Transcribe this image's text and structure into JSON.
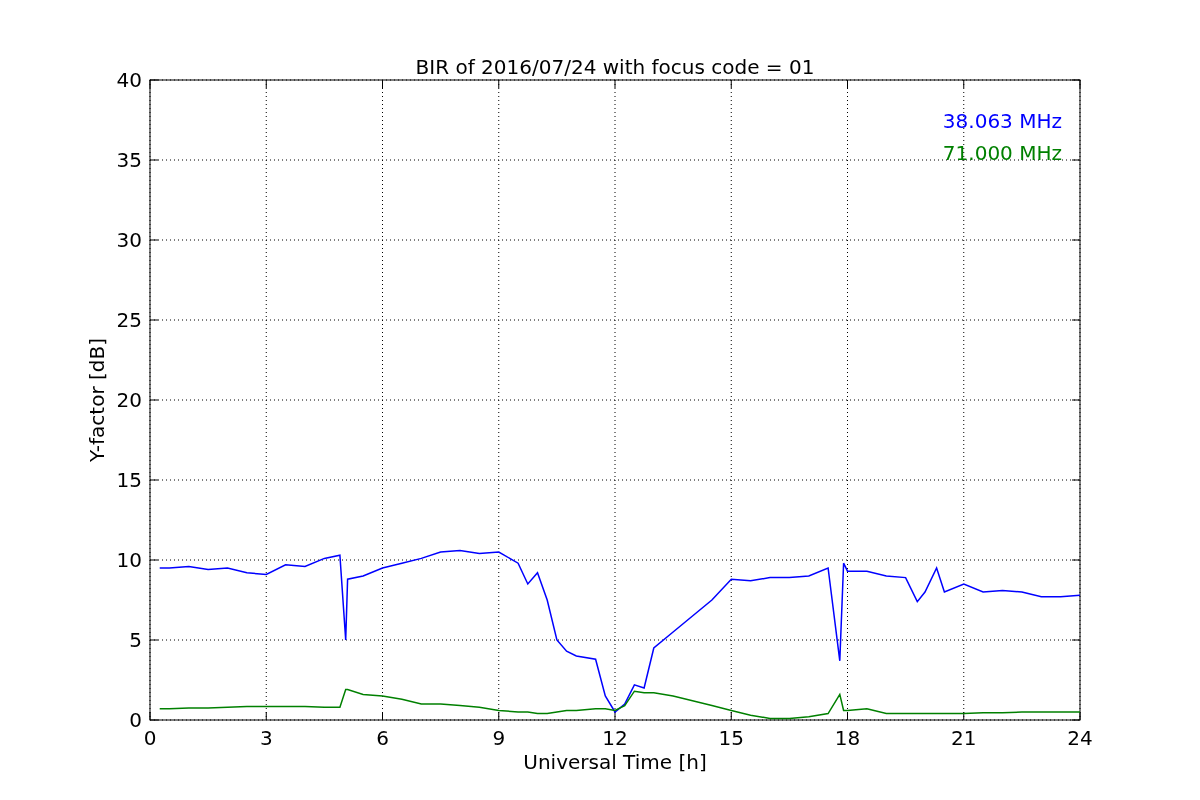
{
  "chart_data": {
    "type": "line",
    "title": "BIR of 2016/07/24 with focus code = 01",
    "xlabel": "Universal Time [h]",
    "ylabel": "Y-factor [dB]",
    "x": [
      0.25,
      0.5,
      1,
      1.5,
      2,
      2.5,
      3,
      3.5,
      4,
      4.5,
      4.9,
      5.05,
      5.1,
      5.5,
      6,
      6.5,
      7,
      7.5,
      8,
      8.5,
      9,
      9.5,
      9.75,
      10,
      10.25,
      10.5,
      10.75,
      11,
      11.5,
      11.75,
      12,
      12.25,
      12.5,
      12.75,
      13,
      13.5,
      14,
      14.5,
      15,
      15.5,
      16,
      16.5,
      17,
      17.5,
      17.8,
      17.9,
      18,
      18.5,
      19,
      19.5,
      19.8,
      20,
      20.3,
      20.5,
      21,
      21.5,
      22,
      22.5,
      23,
      23.5,
      24
    ],
    "series": [
      {
        "name": "38.063 MHz",
        "color": "#0000ff",
        "values": [
          9.5,
          9.5,
          9.6,
          9.4,
          9.5,
          9.2,
          9.1,
          9.7,
          9.6,
          10.1,
          10.3,
          5.0,
          8.8,
          9.0,
          9.5,
          9.8,
          10.1,
          10.5,
          10.6,
          10.4,
          10.5,
          9.8,
          8.5,
          9.2,
          7.5,
          5.0,
          4.3,
          4.0,
          3.8,
          1.5,
          0.5,
          1.0,
          2.2,
          2.0,
          4.5,
          5.5,
          6.5,
          7.5,
          8.8,
          8.7,
          8.9,
          8.9,
          9.0,
          9.5,
          3.7,
          9.8,
          9.3,
          9.3,
          9.0,
          8.9,
          7.4,
          8.0,
          9.5,
          8.0,
          8.5,
          8.0,
          8.1,
          8.0,
          7.7,
          7.7,
          7.8
        ]
      },
      {
        "name": "71.000 MHz",
        "color": "#008000",
        "values": [
          0.7,
          0.7,
          0.75,
          0.75,
          0.8,
          0.85,
          0.85,
          0.85,
          0.85,
          0.8,
          0.8,
          1.9,
          1.9,
          1.6,
          1.5,
          1.3,
          1.0,
          1.0,
          0.9,
          0.8,
          0.6,
          0.5,
          0.5,
          0.4,
          0.4,
          0.5,
          0.6,
          0.6,
          0.7,
          0.7,
          0.6,
          0.9,
          1.8,
          1.7,
          1.7,
          1.5,
          1.2,
          0.9,
          0.6,
          0.3,
          0.1,
          0.1,
          0.2,
          0.4,
          1.6,
          0.6,
          0.6,
          0.7,
          0.4,
          0.4,
          0.4,
          0.4,
          0.4,
          0.4,
          0.4,
          0.45,
          0.45,
          0.5,
          0.5,
          0.5,
          0.5
        ]
      }
    ],
    "grid": true,
    "xlim": [
      0,
      24
    ],
    "ylim": [
      0,
      40
    ],
    "xticks": [
      0,
      3,
      6,
      9,
      12,
      15,
      18,
      21,
      24
    ],
    "yticks": [
      0,
      5,
      10,
      15,
      20,
      25,
      30,
      35,
      40
    ]
  }
}
